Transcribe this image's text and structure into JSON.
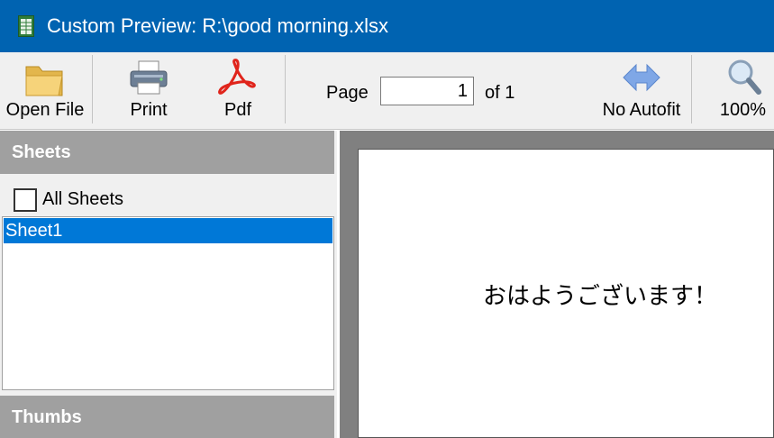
{
  "window": {
    "title": "Custom Preview: R:\\good morning.xlsx",
    "icon": "spreadsheet-icon"
  },
  "toolbar": {
    "open_file": {
      "label": "Open File",
      "icon": "folder-icon"
    },
    "print": {
      "label": "Print",
      "icon": "printer-icon"
    },
    "pdf": {
      "label": "Pdf",
      "icon": "pdf-icon"
    },
    "page_label": "Page",
    "page_value": "1",
    "page_of": "of 1",
    "autofit": {
      "label": "No Autofit",
      "icon": "autofit-arrows-icon"
    },
    "zoom": {
      "label": "100%",
      "icon": "magnifier-icon"
    }
  },
  "sidebar": {
    "sheets_header": "Sheets",
    "all_sheets_label": "All Sheets",
    "all_sheets_checked": false,
    "sheets": [
      {
        "label": "Sheet1",
        "selected": true
      }
    ],
    "thumbs_header": "Thumbs"
  },
  "preview": {
    "cell_text": "おはようございます！"
  },
  "colors": {
    "titlebar": "#0063b1",
    "selection": "#0078d7",
    "section_header": "#a0a0a0",
    "preview_bg": "#808080"
  }
}
